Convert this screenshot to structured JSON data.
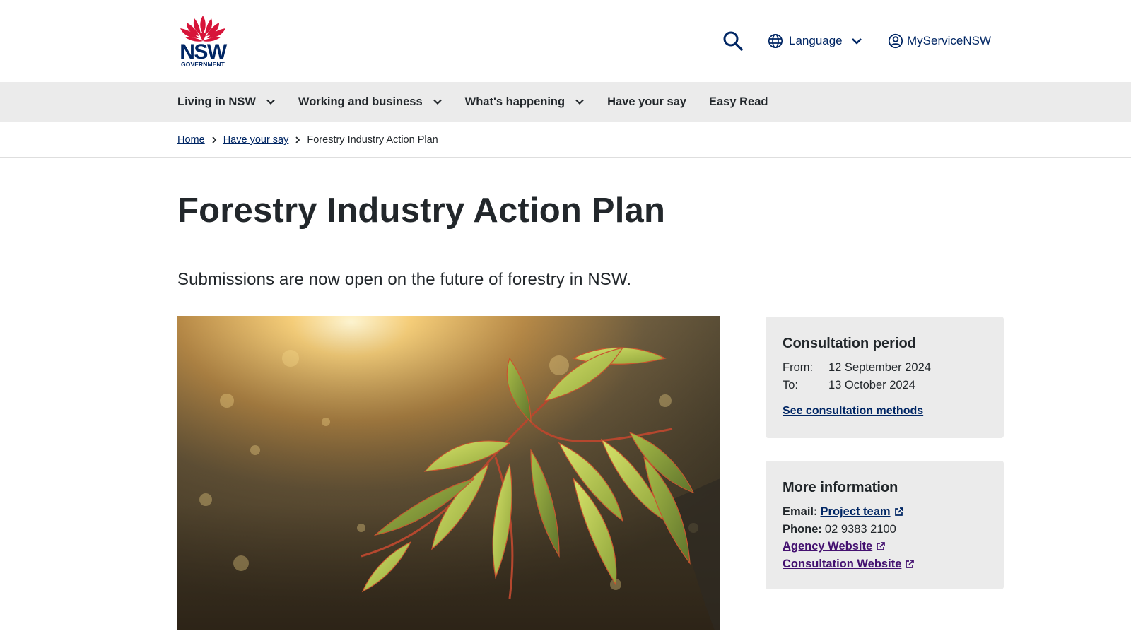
{
  "header": {
    "logo": {
      "wordmark": "NSW",
      "subtitle": "GOVERNMENT"
    },
    "search_icon": "search-icon",
    "language_label": "Language",
    "account_label": "MyServiceNSW"
  },
  "nav": {
    "items": [
      {
        "label": "Living in NSW",
        "has_dropdown": true
      },
      {
        "label": "Working and business",
        "has_dropdown": true
      },
      {
        "label": "What's happening",
        "has_dropdown": true
      },
      {
        "label": "Have your say",
        "has_dropdown": false
      },
      {
        "label": "Easy Read",
        "has_dropdown": false
      }
    ]
  },
  "breadcrumb": {
    "home": "Home",
    "parent": "Have your say",
    "current": "Forestry Industry Action Plan"
  },
  "page": {
    "title": "Forestry Industry Action Plan",
    "intro": "Submissions are now open on the future of forestry in NSW."
  },
  "consultation": {
    "heading": "Consultation period",
    "from_label": "From:",
    "from_value": "12 September 2024",
    "to_label": "To:",
    "to_value": "13 October 2024",
    "methods_link": "See consultation methods"
  },
  "more_info": {
    "heading": "More information",
    "email_label": "Email:",
    "email_link": "Project team",
    "phone_label": "Phone:",
    "phone_value": "02 9383 2100",
    "agency_link": "Agency Website",
    "consultation_link": "Consultation Website"
  },
  "colors": {
    "brand_navy": "#002664",
    "brand_red": "#d7153a",
    "visited_purple": "#441170",
    "nav_bg": "#ebebeb",
    "text": "#22272b"
  }
}
